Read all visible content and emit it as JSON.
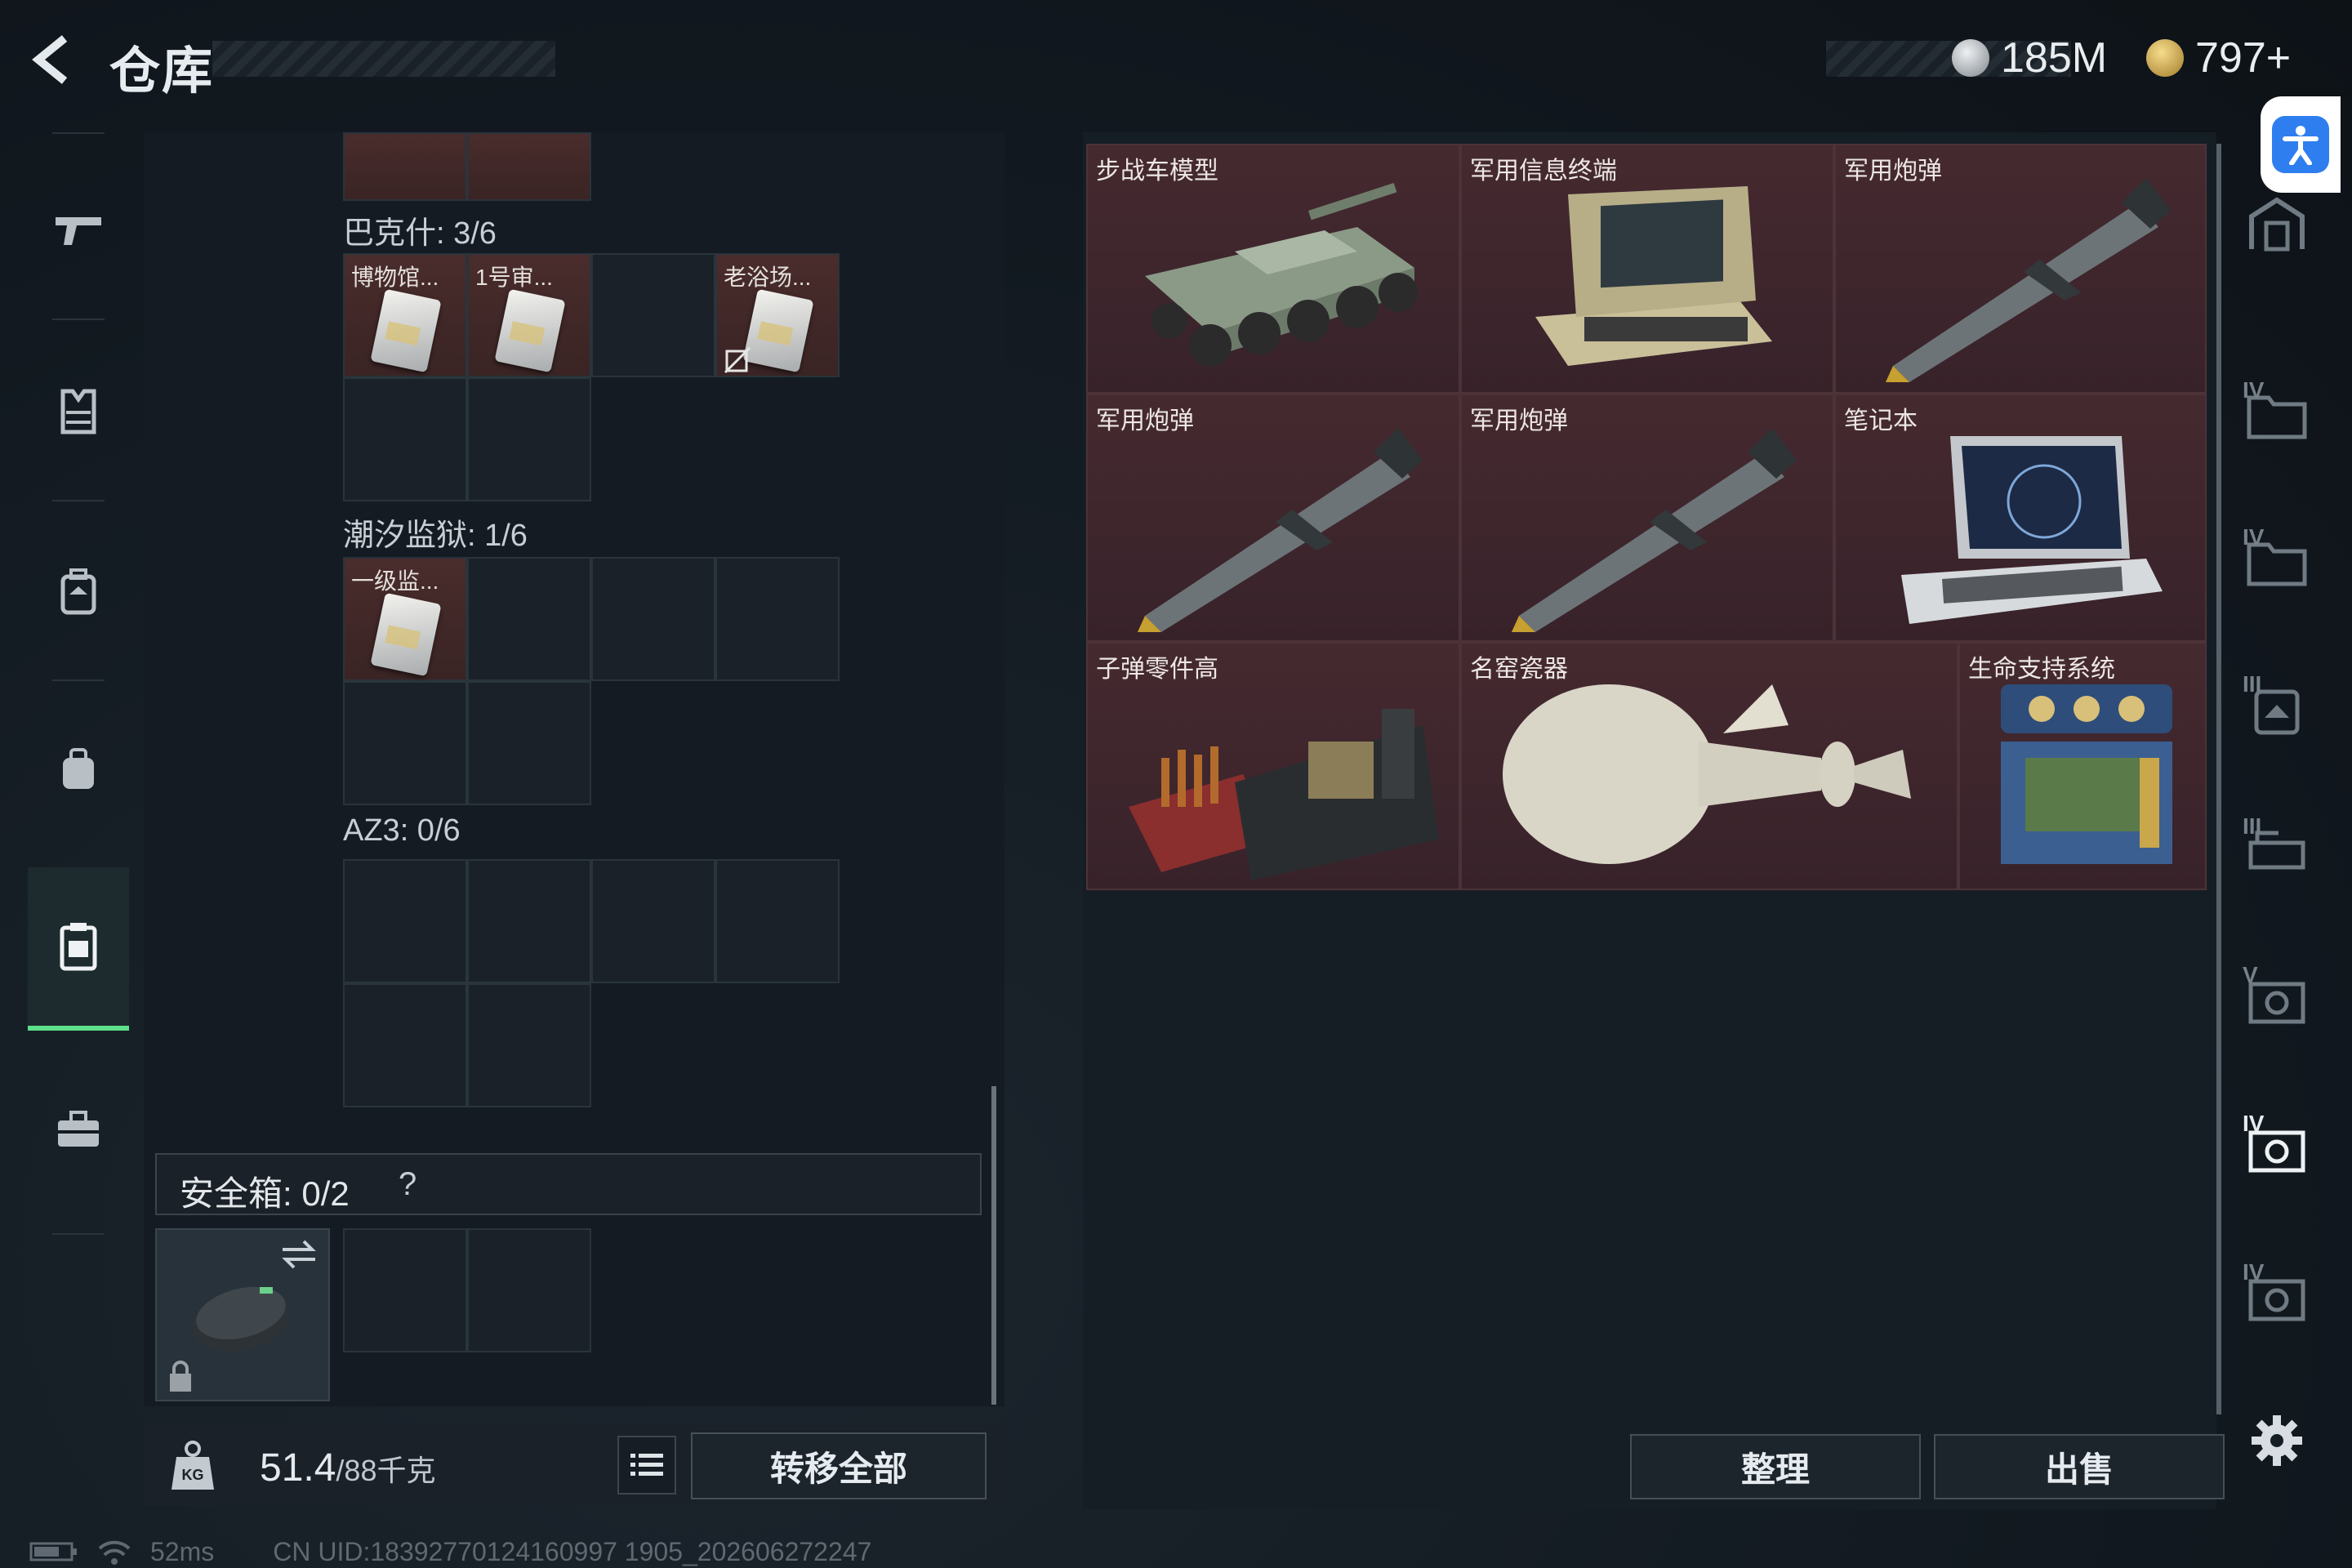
{
  "header": {
    "title": "仓库",
    "currency_silver": "185M",
    "currency_gold": "797+"
  },
  "left_nav": [
    {
      "name": "weapons"
    },
    {
      "name": "armor"
    },
    {
      "name": "backpack"
    },
    {
      "name": "rig"
    },
    {
      "name": "containers"
    },
    {
      "name": "toolbox"
    }
  ],
  "containers": {
    "bakshi": {
      "label": "巴克什: 3/6",
      "items": [
        "博物馆...",
        "1号审...",
        "老浴场..."
      ]
    },
    "tidal": {
      "label": "潮汐监狱: 1/6",
      "items": [
        "一级监..."
      ]
    },
    "az3": {
      "label": "AZ3: 0/6"
    }
  },
  "safebox": {
    "label": "安全箱: 0/2",
    "help": "?"
  },
  "bottom": {
    "weight_value": "51.4",
    "weight_max": "/88千克",
    "transfer_all": "转移全部"
  },
  "stash_items": [
    {
      "label": "步战车模型"
    },
    {
      "label": "军用信息终端"
    },
    {
      "label": "军用炮弹"
    },
    {
      "label": "军用炮弹"
    },
    {
      "label": "军用炮弹"
    },
    {
      "label": "笔记本"
    },
    {
      "label": "子弹零件高"
    },
    {
      "label": "名窑瓷器"
    },
    {
      "label": "生命支持系统"
    }
  ],
  "right_actions": {
    "sort": "整理",
    "sell": "出售"
  },
  "right_nav_tiers": [
    "",
    "IV",
    "IV",
    "III",
    "III",
    "V",
    "IV",
    "IV"
  ],
  "status": {
    "ping": "52ms",
    "uid": "CN UID:18392770124160997 1905_202606272247"
  },
  "colors": {
    "accent_green": "#5de08a",
    "item_bg": "#3c2429",
    "panel_bg": "#141b22"
  }
}
